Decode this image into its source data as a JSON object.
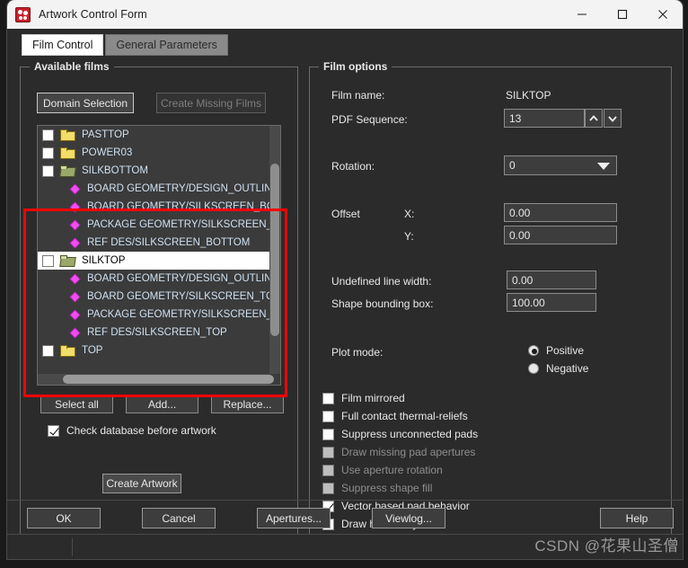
{
  "window": {
    "title": "Artwork Control Form",
    "icon": "allegro-app-icon",
    "controls": {
      "minimize": "minimize",
      "maximize": "maximize",
      "close": "close"
    }
  },
  "tabs": [
    {
      "label": "Film Control",
      "active": true
    },
    {
      "label": "General Parameters",
      "active": false
    }
  ],
  "available_films": {
    "legend": "Available films",
    "domain_selection_label": "Domain Selection",
    "create_missing_films_label": "Create Missing Films",
    "tree": [
      {
        "label": "PASTTOP",
        "type": "folder",
        "checked": false,
        "indent": 0,
        "selected": false
      },
      {
        "label": "POWER03",
        "type": "folder",
        "checked": false,
        "indent": 0,
        "selected": false
      },
      {
        "label": "SILKBOTTOM",
        "type": "folder-open",
        "checked": false,
        "indent": 0,
        "selected": false
      },
      {
        "label": "BOARD GEOMETRY/DESIGN_OUTLINE",
        "type": "layer",
        "indent": 1,
        "selected": false
      },
      {
        "label": "BOARD GEOMETRY/SILKSCREEN_BOTTOM",
        "type": "layer",
        "indent": 1,
        "selected": false
      },
      {
        "label": "PACKAGE GEOMETRY/SILKSCREEN_BOTTOM",
        "type": "layer",
        "indent": 1,
        "selected": false
      },
      {
        "label": "REF DES/SILKSCREEN_BOTTOM",
        "type": "layer",
        "indent": 1,
        "selected": false
      },
      {
        "label": "SILKTOP",
        "type": "folder-open",
        "checked": false,
        "indent": 0,
        "selected": true
      },
      {
        "label": "BOARD GEOMETRY/DESIGN_OUTLINE",
        "type": "layer",
        "indent": 1,
        "selected": false
      },
      {
        "label": "BOARD GEOMETRY/SILKSCREEN_TOP",
        "type": "layer",
        "indent": 1,
        "selected": false
      },
      {
        "label": "PACKAGE GEOMETRY/SILKSCREEN_TOP",
        "type": "layer",
        "indent": 1,
        "selected": false
      },
      {
        "label": "REF DES/SILKSCREEN_TOP",
        "type": "layer",
        "indent": 1,
        "selected": false
      },
      {
        "label": "TOP",
        "type": "folder",
        "checked": false,
        "indent": 0,
        "selected": false
      }
    ],
    "select_all_label": "Select all",
    "add_label": "Add...",
    "replace_label": "Replace...",
    "check_database_label": "Check database before artwork",
    "check_database_checked": true,
    "create_artwork_label": "Create Artwork"
  },
  "film_options": {
    "legend": "Film options",
    "film_name_label": "Film name:",
    "film_name_value": "SILKTOP",
    "pdf_sequence_label": "PDF Sequence:",
    "pdf_sequence_value": "13",
    "rotation_label": "Rotation:",
    "rotation_value": "0",
    "offset_label": "Offset",
    "offset_x_label": "X:",
    "offset_x_value": "0.00",
    "offset_y_label": "Y:",
    "offset_y_value": "0.00",
    "undefined_line_width_label": "Undefined line width:",
    "undefined_line_width_value": "0.00",
    "shape_bounding_box_label": "Shape bounding box:",
    "shape_bounding_box_value": "100.00",
    "plot_mode_label": "Plot mode:",
    "plot_mode_options": [
      {
        "label": "Positive",
        "selected": true
      },
      {
        "label": "Negative",
        "selected": false
      }
    ],
    "checkboxes": [
      {
        "label": "Film mirrored",
        "checked": false,
        "disabled": false
      },
      {
        "label": "Full contact thermal-reliefs",
        "checked": false,
        "disabled": false
      },
      {
        "label": "Suppress unconnected pads",
        "checked": false,
        "disabled": false
      },
      {
        "label": "Draw missing pad apertures",
        "checked": false,
        "disabled": true
      },
      {
        "label": "Use aperture rotation",
        "checked": false,
        "disabled": true
      },
      {
        "label": "Suppress shape fill",
        "checked": false,
        "disabled": true
      },
      {
        "label": "Vector based pad behavior",
        "checked": true,
        "disabled": false
      },
      {
        "label": "Draw holes only",
        "checked": false,
        "disabled": false
      }
    ]
  },
  "footer": {
    "ok": "OK",
    "cancel": "Cancel",
    "apertures": "Apertures...",
    "viewlog": "Viewlog...",
    "help": "Help"
  },
  "watermark": "CSDN @花果山圣僧",
  "colors": {
    "window_bg": "#2b2b2b",
    "titlebar_bg": "#f3f3f3",
    "annotation": "#ff0000",
    "list_bg": "#3b3b3b",
    "layer_icon": "#ef4df0",
    "folder_icon": "#f2dc6a"
  }
}
